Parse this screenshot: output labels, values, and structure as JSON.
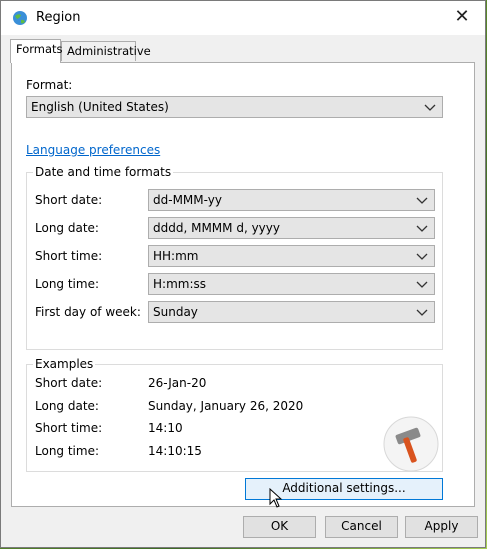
{
  "window": {
    "title": "Region",
    "close_glyph": "✕"
  },
  "tabs": [
    {
      "label": "Formats"
    },
    {
      "label": "Administrative"
    }
  ],
  "format": {
    "label": "Format:",
    "value": "English (United States)"
  },
  "language_link": "Language preferences",
  "date_time": {
    "legend": "Date and time formats",
    "rows": [
      {
        "label": "Short date:",
        "value": "dd-MMM-yy"
      },
      {
        "label": "Long date:",
        "value": "dddd, MMMM d, yyyy"
      },
      {
        "label": "Short time:",
        "value": "HH:mm"
      },
      {
        "label": "Long time:",
        "value": "H:mm:ss"
      },
      {
        "label": "First day of week:",
        "value": "Sunday"
      }
    ]
  },
  "examples": {
    "legend": "Examples",
    "rows": [
      {
        "label": "Short date:",
        "value": "26-Jan-20"
      },
      {
        "label": "Long date:",
        "value": "Sunday, January 26, 2020"
      },
      {
        "label": "Short time:",
        "value": "14:10"
      },
      {
        "label": "Long time:",
        "value": "14:10:15"
      }
    ]
  },
  "buttons": {
    "additional": "Additional settings...",
    "ok": "OK",
    "cancel": "Cancel",
    "apply": "Apply"
  },
  "colors": {
    "link": "#0066cc",
    "focus_border": "#0078d7"
  }
}
